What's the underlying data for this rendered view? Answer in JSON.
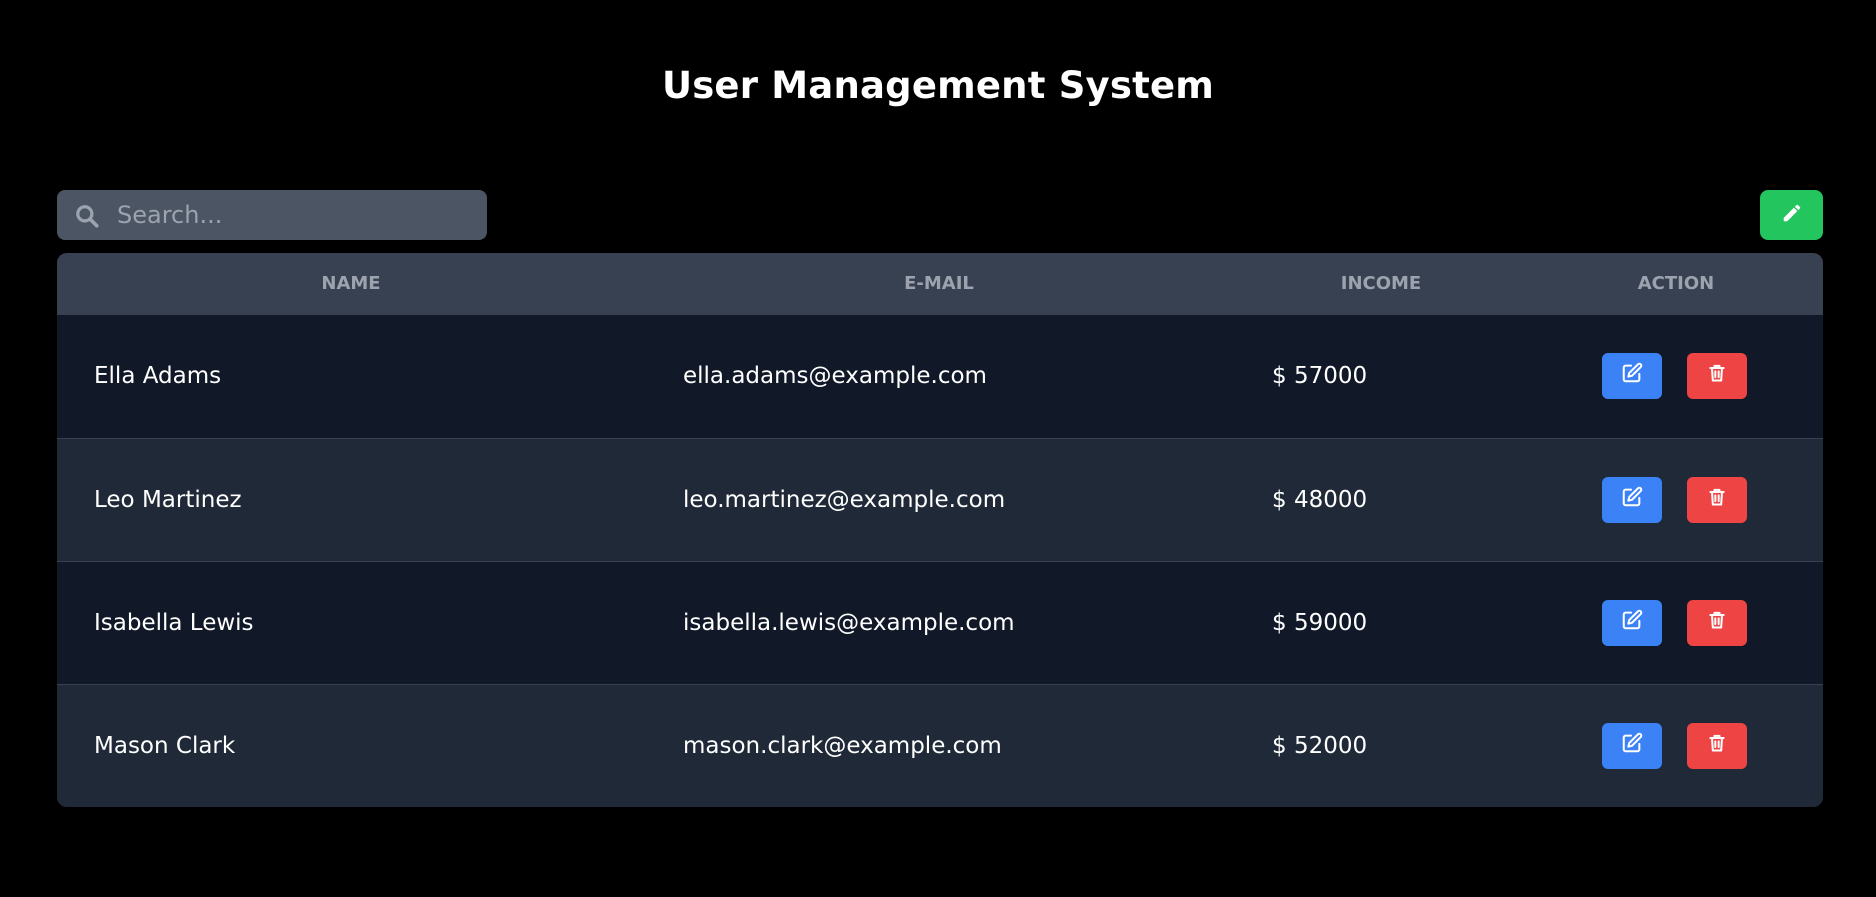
{
  "header": {
    "title": "User Management System"
  },
  "search": {
    "placeholder": "Search...",
    "value": "",
    "icon": "search-icon"
  },
  "toolbar": {
    "add_icon": "pencil-icon"
  },
  "table": {
    "columns": [
      "NAME",
      "E-MAIL",
      "INCOME",
      "ACTION"
    ],
    "rows": [
      {
        "name": "Ella Adams",
        "email": "ella.adams@example.com",
        "income": "$ 57000"
      },
      {
        "name": "Leo Martinez",
        "email": "leo.martinez@example.com",
        "income": "$ 48000"
      },
      {
        "name": "Isabella Lewis",
        "email": "isabella.lewis@example.com",
        "income": "$ 59000"
      },
      {
        "name": "Mason Clark",
        "email": "mason.clark@example.com",
        "income": "$ 52000"
      }
    ],
    "edit_icon": "edit-icon",
    "delete_icon": "trash-icon"
  },
  "colors": {
    "background": "#000000",
    "search_bg": "#4b5563",
    "header_bg": "#374151",
    "row_dark": "#111827",
    "row_light": "#1f2937",
    "add_button": "#22c55e",
    "edit_button": "#3b82f6",
    "delete_button": "#ef4444"
  }
}
